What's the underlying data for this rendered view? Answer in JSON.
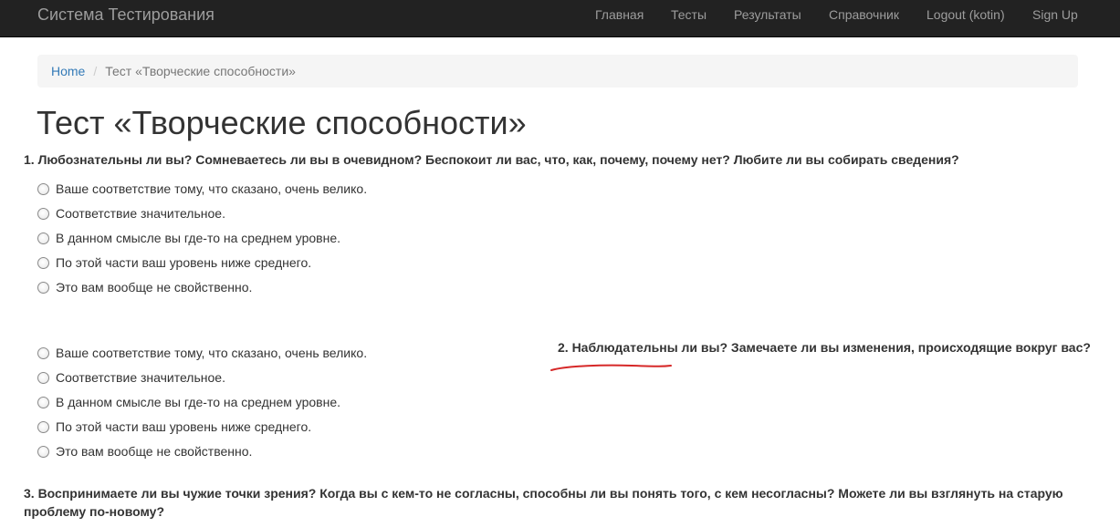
{
  "navbar": {
    "brand": "Система Тестирования",
    "items": [
      "Главная",
      "Тесты",
      "Результаты",
      "Справочник",
      "Logout (kotin)",
      "Sign Up"
    ]
  },
  "breadcrumb": {
    "home": "Home",
    "separator": "/",
    "active": "Тест «Творческие способности»"
  },
  "page": {
    "title": "Тест «Творческие способности»"
  },
  "questions": [
    {
      "text": "1. Любознательны ли вы? Сомневаетесь ли вы в очевидном? Беспокоит ли вас, что, как, почему, почему нет? Любите ли вы собирать сведения?",
      "options": [
        "Ваше соответствие тому, что сказано, очень велико.",
        "Соответствие значительное.",
        "В данном смысле вы где-то на среднем уровне.",
        "По этой части ваш уровень ниже среднего.",
        "Это вам вообще не свойственно."
      ]
    },
    {
      "text": "2. Наблюдательны ли вы? Замечаете ли вы изменения, происходящие вокруг вас?",
      "options": [
        "Ваше соответствие тому, что сказано, очень велико.",
        "Соответствие значительное.",
        "В данном смысле вы где-то на среднем уровне.",
        "По этой части ваш уровень ниже среднего.",
        "Это вам вообще не свойственно."
      ]
    },
    {
      "text": "3. Воспринимаете ли вы чужие точки зрения? Когда вы с кем-то не согласны, способны ли вы понять того, с кем несогласны? Можете ли вы взглянуть на старую проблему по-новому?",
      "options": []
    }
  ],
  "colors": {
    "navbar_bg": "#222222",
    "navbar_text": "#9d9d9d",
    "link": "#337ab7",
    "annotation": "#d62828"
  }
}
